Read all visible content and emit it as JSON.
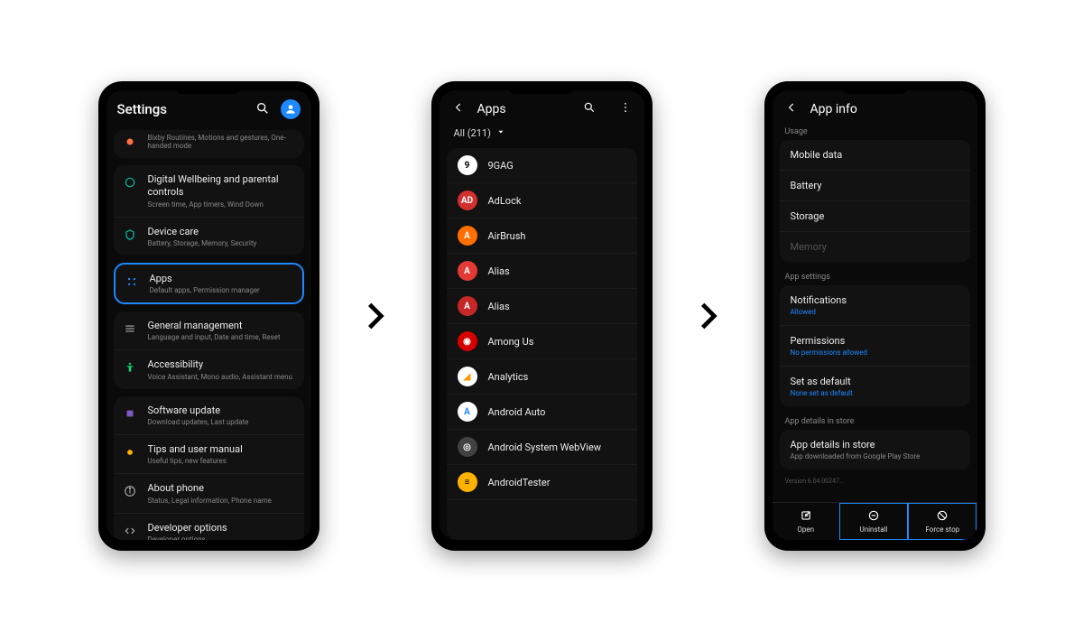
{
  "phone1": {
    "title": "Settings",
    "truncated": {
      "subtitle": "Bixby Routines, Motions and gestures, One-handed mode"
    },
    "group1": [
      {
        "title": "Digital Wellbeing and parental controls",
        "subtitle": "Screen time, App timers, Wind Down",
        "icon": "wellbeing",
        "color": "#00bfa5"
      },
      {
        "title": "Device care",
        "subtitle": "Battery, Storage, Memory, Security",
        "icon": "device-care",
        "color": "#00bfa5"
      }
    ],
    "highlighted": {
      "title": "Apps",
      "subtitle": "Default apps, Permission manager",
      "icon": "apps-grid",
      "color": "#1e88ff"
    },
    "group2": [
      {
        "title": "General management",
        "subtitle": "Language and input, Date and time, Reset",
        "icon": "general",
        "color": "#888"
      },
      {
        "title": "Accessibility",
        "subtitle": "Voice Assistant, Mono audio, Assistant menu",
        "icon": "accessibility",
        "color": "#00e676"
      }
    ],
    "group3": [
      {
        "title": "Software update",
        "subtitle": "Download updates, Last update",
        "icon": "update",
        "color": "#7e57c2"
      },
      {
        "title": "Tips and user manual",
        "subtitle": "Useful tips, new features",
        "icon": "tips",
        "color": "#ffb300"
      },
      {
        "title": "About phone",
        "subtitle": "Status, Legal information, Phone name",
        "icon": "info",
        "color": "#888"
      },
      {
        "title": "Developer options",
        "subtitle": "Developer options",
        "icon": "dev",
        "color": "#888"
      }
    ]
  },
  "phone2": {
    "title": "Apps",
    "filter": "All (211)",
    "apps": [
      {
        "name": "9GAG",
        "bg": "#fff",
        "fg": "#000",
        "letter": "9"
      },
      {
        "name": "AdLock",
        "bg": "#d32f2f",
        "fg": "#fff",
        "letter": "AD"
      },
      {
        "name": "AirBrush",
        "bg": "#ff6f00",
        "fg": "#fff",
        "letter": "A"
      },
      {
        "name": "Alias",
        "bg": "#e53935",
        "fg": "#fff",
        "letter": "A"
      },
      {
        "name": "Alias",
        "bg": "#c62828",
        "fg": "#fff",
        "letter": "A"
      },
      {
        "name": "Among Us",
        "bg": "#d50000",
        "fg": "#fff",
        "letter": "◉"
      },
      {
        "name": "Analytics",
        "bg": "#fff",
        "fg": "#ff9800",
        "letter": "◢"
      },
      {
        "name": "Android Auto",
        "bg": "#fff",
        "fg": "#1e88ff",
        "letter": "A"
      },
      {
        "name": "Android System WebView",
        "bg": "#424242",
        "fg": "#fff",
        "letter": "◎"
      },
      {
        "name": "AndroidTester",
        "bg": "#ffb300",
        "fg": "#000",
        "letter": "≡"
      }
    ]
  },
  "phone3": {
    "title": "App info",
    "sections": {
      "usage": {
        "header": "Usage",
        "items": [
          {
            "title": "Mobile data"
          },
          {
            "title": "Battery"
          },
          {
            "title": "Storage"
          },
          {
            "title": "Memory",
            "disabled": true
          }
        ]
      },
      "app_settings": {
        "header": "App settings",
        "items": [
          {
            "title": "Notifications",
            "sub": "Allowed",
            "blue": true
          },
          {
            "title": "Permissions",
            "sub": "No permissions allowed",
            "blue": true
          },
          {
            "title": "Set as default",
            "sub": "None set as default",
            "blue": true
          }
        ]
      },
      "store": {
        "header": "App details in store",
        "items": [
          {
            "title": "App details in store",
            "sub": "App downloaded from Google Play Store",
            "blue": false
          }
        ]
      }
    },
    "version": "Version 6.04.00247…",
    "buttons": [
      {
        "label": "Open",
        "icon": "open",
        "highlighted": false
      },
      {
        "label": "Uninstall",
        "icon": "uninstall",
        "highlighted": true
      },
      {
        "label": "Force stop",
        "icon": "forcestop",
        "highlighted": true
      }
    ]
  }
}
